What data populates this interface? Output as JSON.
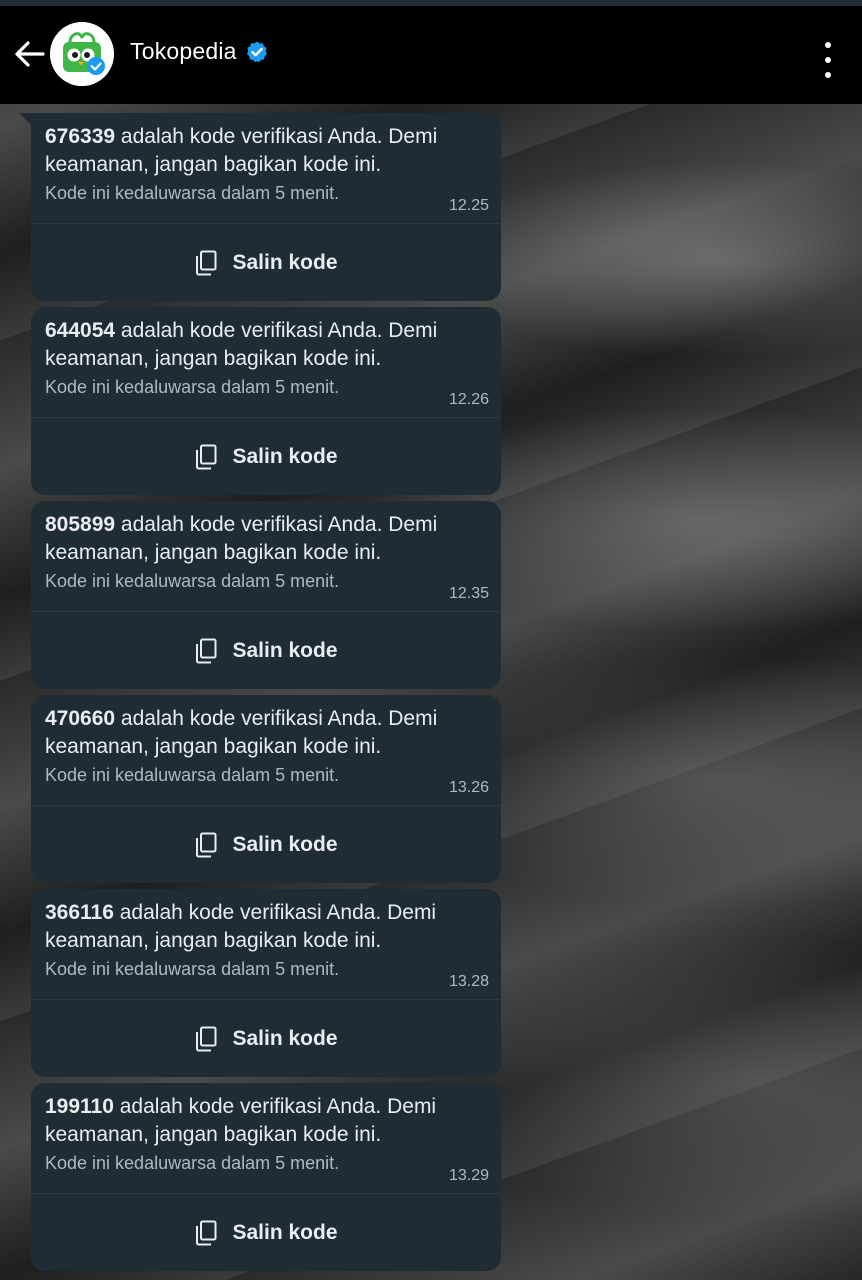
{
  "header": {
    "title": "Tokopedia",
    "back_icon": "arrow-left-icon",
    "verified_icon": "verified-badge-icon",
    "menu_icon": "more-vertical-icon"
  },
  "colors": {
    "bubble": "#1f2c34",
    "verified": "#1d9bf0",
    "brand": "#42b549"
  },
  "messages": [
    {
      "code": "676339",
      "text": " adalah kode verifikasi Anda. Demi keamanan, jangan bagikan kode ini.",
      "note": "Kode ini kedaluwarsa dalam 5 menit.",
      "time": "12.25",
      "action": "Salin kode"
    },
    {
      "code": "644054",
      "text": " adalah kode verifikasi Anda. Demi keamanan, jangan bagikan kode ini.",
      "note": "Kode ini kedaluwarsa dalam 5 menit.",
      "time": "12.26",
      "action": "Salin kode"
    },
    {
      "code": "805899",
      "text": " adalah kode verifikasi Anda. Demi keamanan, jangan bagikan kode ini.",
      "note": "Kode ini kedaluwarsa dalam 5 menit.",
      "time": "12.35",
      "action": "Salin kode"
    },
    {
      "code": "470660",
      "text": " adalah kode verifikasi Anda. Demi keamanan, jangan bagikan kode ini.",
      "note": "Kode ini kedaluwarsa dalam 5 menit.",
      "time": "13.26",
      "action": "Salin kode"
    },
    {
      "code": "366116",
      "text": " adalah kode verifikasi Anda. Demi keamanan, jangan bagikan kode ini.",
      "note": "Kode ini kedaluwarsa dalam 5 menit.",
      "time": "13.28",
      "action": "Salin kode"
    },
    {
      "code": "199110",
      "text": " adalah kode verifikasi Anda. Demi keamanan, jangan bagikan kode ini.",
      "note": "Kode ini kedaluwarsa dalam 5 menit.",
      "time": "13.29",
      "action": "Salin kode"
    }
  ]
}
